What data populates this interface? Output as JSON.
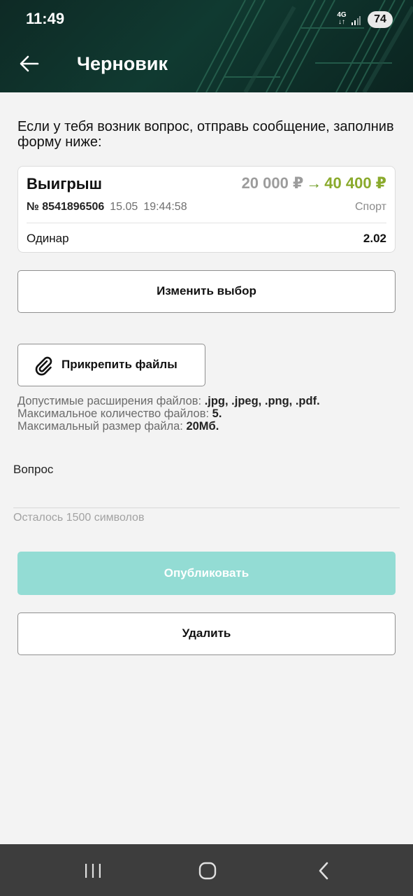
{
  "status_bar": {
    "time": "11:49",
    "network_top": "4G",
    "network_bottom": "↓↑",
    "battery": "74"
  },
  "header": {
    "title": "Черновик",
    "back_icon": "arrow-left-icon"
  },
  "intro_text": "Если у тебя возник вопрос, отправь сообщение, заполнив форму ниже:",
  "bet_card": {
    "status": "Выигрыш",
    "stake": "20 000 ₽",
    "arrow": "→",
    "payout": "40 400 ₽",
    "number": "№ 8541896506",
    "date": "15.05",
    "time": "19:44:58",
    "category": "Спорт",
    "bet_type": "Одинар",
    "coefficient": "2.02",
    "colors": {
      "stake": "#9c9c9c",
      "payout": "#8aaa2c"
    }
  },
  "buttons": {
    "change_choice": "Изменить выбор",
    "attach_files": "Прикрепить файлы",
    "publish": "Опубликовать",
    "delete": "Удалить"
  },
  "file_rules": {
    "extensions_label": "Допустимые расширения файлов: ",
    "extensions_value": ".jpg, .jpeg, .png, .pdf.",
    "max_count_label": "Максимальное количество файлов: ",
    "max_count_value": "5.",
    "max_size_label": "Максимальный размер файла: ",
    "max_size_value": "20Мб."
  },
  "question": {
    "label": "Вопрос",
    "value": "",
    "chars_left": "Осталось 1500 символов"
  },
  "nav": {
    "recent_icon": "recent-apps-icon",
    "home_icon": "home-icon",
    "back_icon": "back-icon"
  },
  "colors": {
    "header_bg": "#0e2a25",
    "publish_bg": "#93dcd4",
    "navbar_bg": "#3d3d3d"
  }
}
